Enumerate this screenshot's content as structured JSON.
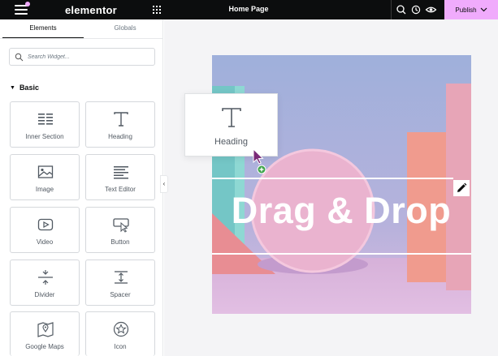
{
  "topbar": {
    "logo": "elementor",
    "page_title": "Home Page",
    "publish_label": "Publish",
    "icons": [
      "menu-icon",
      "apps-icon",
      "search-icon",
      "history-icon",
      "preview-eye-icon",
      "chevron-down-icon"
    ],
    "accent": "#f0abfc",
    "background": "#0c0d0e"
  },
  "sidebar": {
    "tabs": [
      {
        "label": "Elements",
        "active": true
      },
      {
        "label": "Globals",
        "active": false
      }
    ],
    "search": {
      "placeholder": "Search Widget...",
      "value": ""
    },
    "section": "Basic",
    "widgets": [
      {
        "label": "Inner Section",
        "icon": "inner-section-icon"
      },
      {
        "label": "Heading",
        "icon": "heading-icon"
      },
      {
        "label": "Image",
        "icon": "image-icon"
      },
      {
        "label": "Text Editor",
        "icon": "text-editor-icon"
      },
      {
        "label": "Video",
        "icon": "video-icon"
      },
      {
        "label": "Button",
        "icon": "button-icon"
      },
      {
        "label": "Divider",
        "icon": "divider-icon"
      },
      {
        "label": "Spacer",
        "icon": "spacer-icon"
      },
      {
        "label": "Google Maps",
        "icon": "google-maps-icon"
      },
      {
        "label": "Icon",
        "icon": "star-icon"
      }
    ]
  },
  "canvas": {
    "hero_text": "Drag & Drop",
    "drag_widget_label": "Heading",
    "edit_icon": "pencil-icon"
  }
}
